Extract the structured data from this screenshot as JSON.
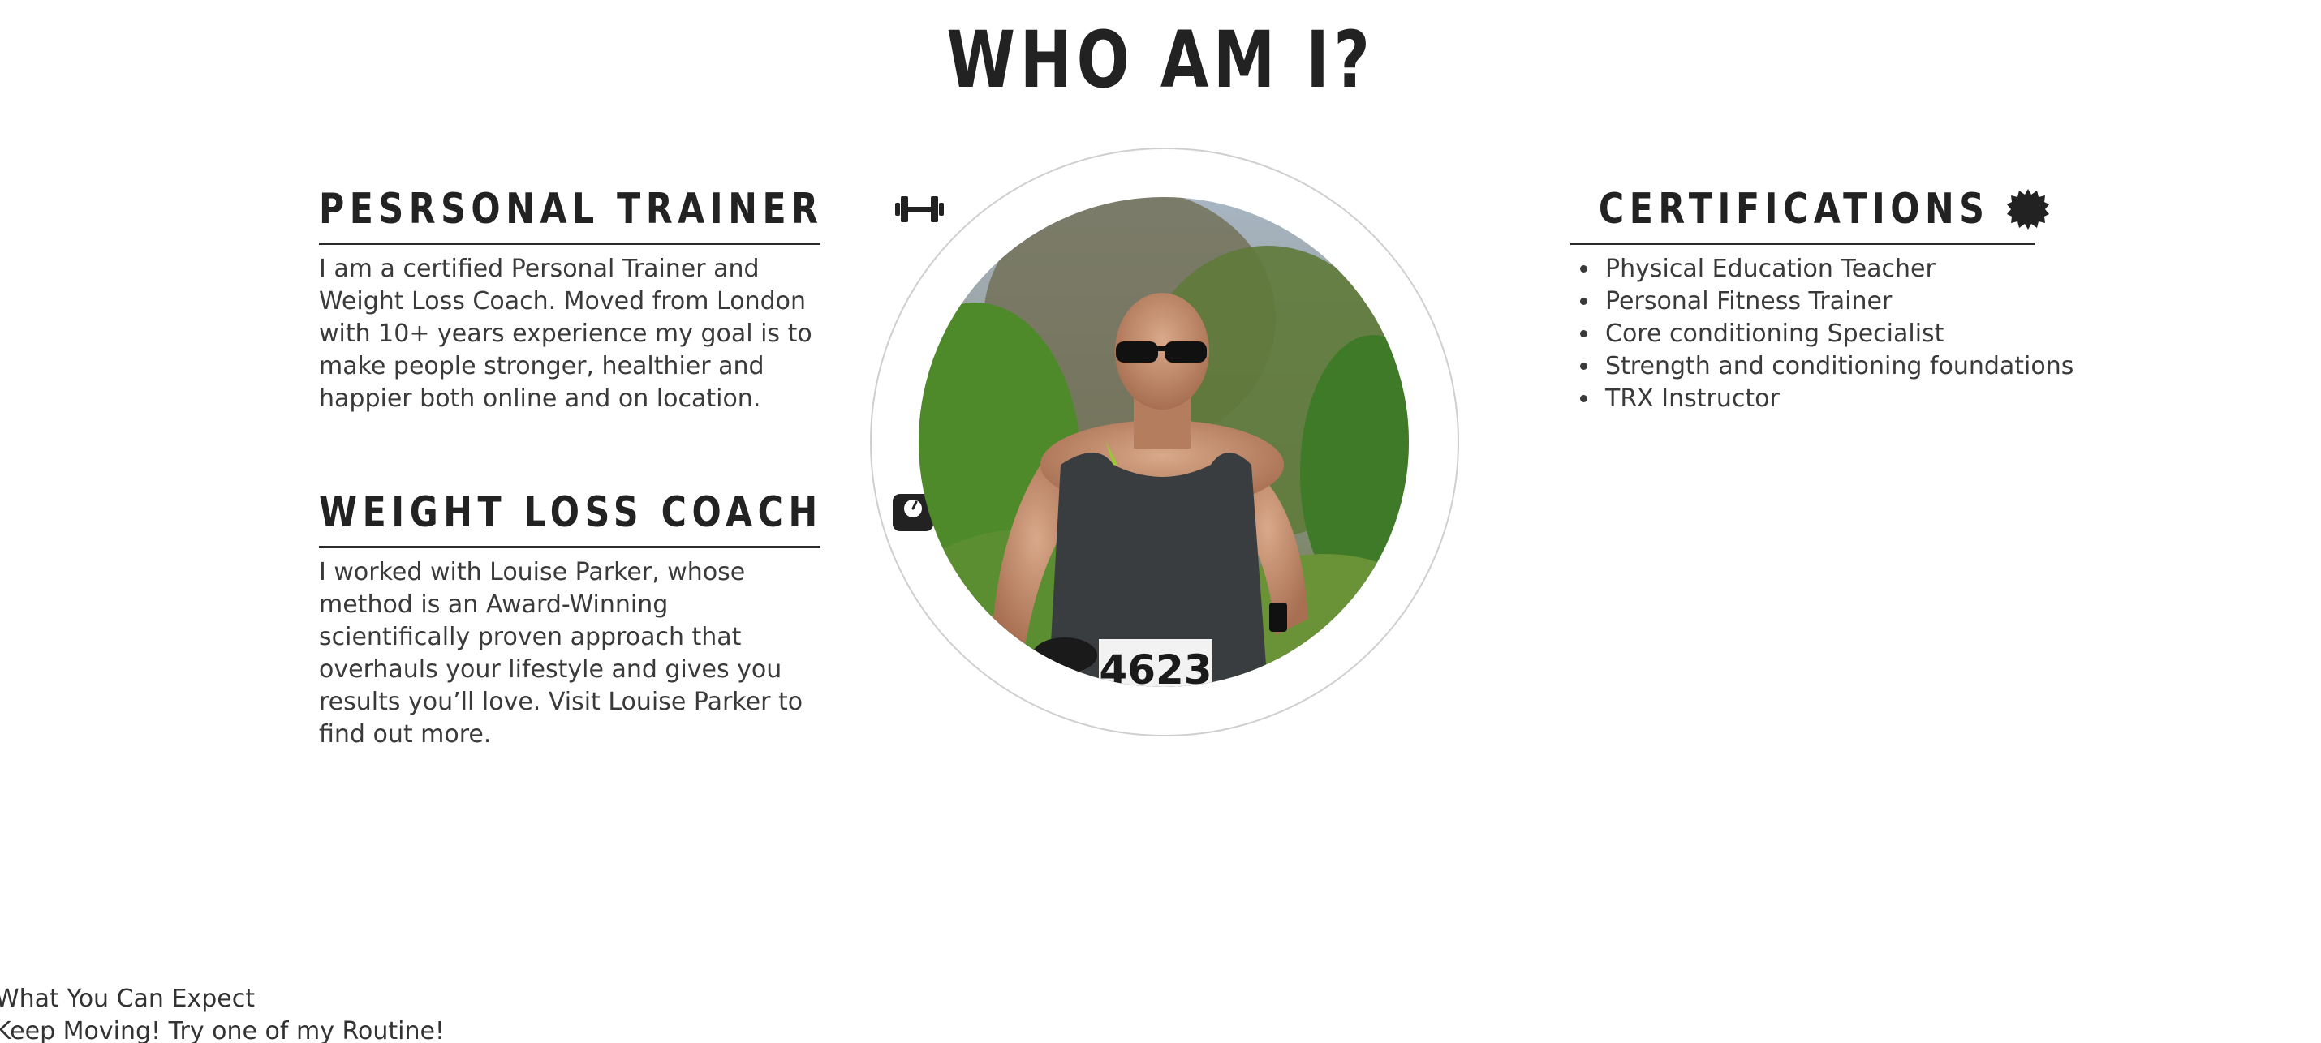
{
  "page_title": "WHO AM I?",
  "personal_trainer": {
    "heading": "PESRSONAL TRAINER",
    "icon": "dumbbell-icon",
    "text": "I am a certified Personal Trainer and Weight Loss Coach. Moved from London with 10+ years experience my goal is to make people stronger, healthier and happier both online and on location."
  },
  "weight_loss_coach": {
    "heading": "WEIGHT LOSS COACH",
    "icon": "weighing-scale-icon",
    "text": "I worked with Louise Parker, whose method is an Award-Winning scientifically proven approach that overhauls your lifestyle and gives you results you’ll love. Visit Louise Parker to find out more."
  },
  "certifications": {
    "heading": "CERTIFICATIONS",
    "icon": "badge-icon",
    "items": [
      "Physical Education Teacher",
      "Personal Fitness Trainer",
      "Core conditioning Specialist",
      "Strength and conditioning foundations",
      "TRX Instructor"
    ]
  },
  "portrait": {
    "bib_number": "4623"
  },
  "footer": {
    "link_1": "What You Can Expect",
    "link_2": "Keep Moving! Try one of my Routine!"
  },
  "colors": {
    "text_dark": "#222222",
    "body_text": "#3a3a3a",
    "ring": "#cfcfcf"
  }
}
